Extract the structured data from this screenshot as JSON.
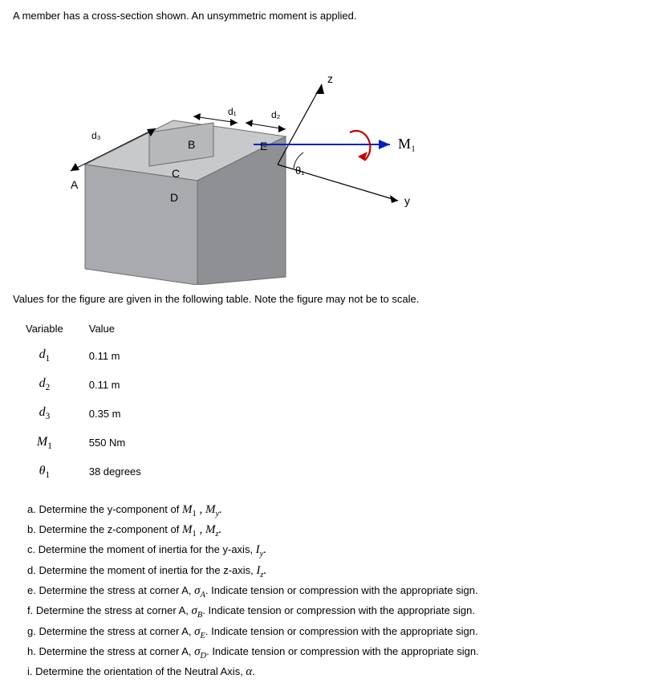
{
  "prompt": "A member has a cross-section shown. An unsymmetric moment is applied.",
  "figure": {
    "labels": {
      "A": "A",
      "B": "B",
      "C": "C",
      "D": "D",
      "E": "E",
      "d1": "d₁",
      "d2": "d₂",
      "d3": "d₃",
      "z": "z",
      "y": "y",
      "theta1": "θ₁",
      "M1": "M₁"
    }
  },
  "table_intro": "Values for the figure are given in the following table. Note the figure may not be to scale.",
  "table": {
    "headers": {
      "variable": "Variable",
      "value": "Value"
    },
    "rows": [
      {
        "name_html": "d<span class='sub'>1</span>",
        "value": "0.11 m",
        "unit": ""
      },
      {
        "name_html": "d<span class='sub'>2</span>",
        "value": "0.11 m",
        "unit": ""
      },
      {
        "name_html": "d<span class='sub'>3</span>",
        "value": "0.35 m",
        "unit": ""
      },
      {
        "name_html": "M<span class='sub'>1</span>",
        "value": "550 Nm",
        "unit": ""
      },
      {
        "name_html": "θ<span class='sub'>1</span>",
        "value": "38 degrees",
        "unit": ""
      }
    ]
  },
  "questions": {
    "a": "a. Determine the y-component of ",
    "a_var": "M₁ , Mᵧ.",
    "b": "b. Determine the z-component of ",
    "b_var": "M₁ , M𝓏.",
    "c": "c. Determine the moment of inertia for the y-axis, ",
    "c_var": "Iᵧ.",
    "d": "d. Determine the moment of inertia for the z-axis, ",
    "d_var": "I𝓏.",
    "e_pre": "e. Determine the stress at corner A, ",
    "e_var": "σA",
    "e_post": ". Indicate tension or compression with the appropriate sign.",
    "f_pre": "f. Determine the stress at corner A, ",
    "f_var": "σB",
    "f_post": ". Indicate tension or compression with the appropriate sign.",
    "g_pre": "g. Determine the stress at corner A, ",
    "g_var": "σE",
    "g_post": ". Indicate tension or compression with the appropriate sign.",
    "h_pre": "h. Determine the stress at corner A, ",
    "h_var": "σD",
    "h_post": ". Indicate tension or compression with the appropriate sign.",
    "i_pre": "i. Determine the orientation of the Neutral Axis, ",
    "i_var": "α",
    "i_post": "."
  }
}
